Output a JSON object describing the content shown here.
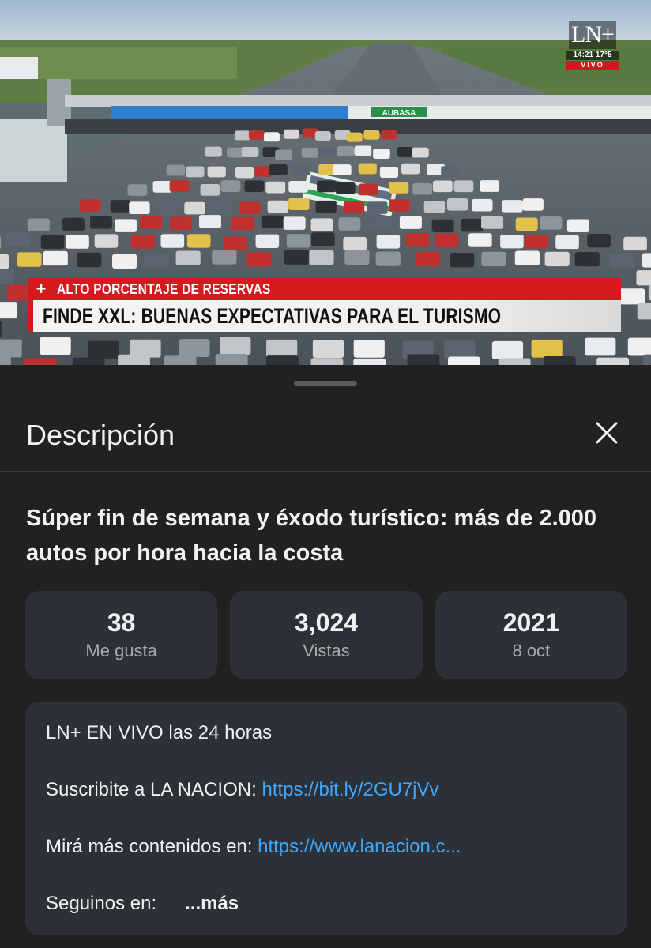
{
  "video": {
    "channel_logo": "LN+",
    "overlay_time": "14:21 17°5",
    "overlay_live": "VIVO",
    "toll_sign": "AUBASA",
    "lower_third": {
      "kicker": "ALTO PORCENTAJE DE RESERVAS",
      "headline": "FINDE XXL: BUENAS EXPECTATIVAS PARA EL TURISMO"
    }
  },
  "sheet": {
    "title": "Descripción",
    "close_icon": "close-icon",
    "video_title": "Súper fin de semana y éxodo turístico: más de 2.000 autos por hora hacia la costa",
    "stats": [
      {
        "value": "38",
        "label": "Me gusta"
      },
      {
        "value": "3,024",
        "label": "Vistas"
      },
      {
        "value": "2021",
        "label": "8 oct"
      }
    ],
    "description": {
      "line1": "LN+ EN VIVO las 24 horas",
      "line2_text": "Suscribite a LA NACION: ",
      "line2_link": "https://bit.ly/2GU7jVv",
      "line3_text": "Mirá más contenidos en: ",
      "line3_link": "https://www.lanacion.c...",
      "line4_text": "Seguinos en:",
      "more_label": "...más"
    }
  },
  "colors": {
    "background": "#0f0f0f",
    "sheet": "#212121",
    "card": "#2b3136",
    "link": "#3ea6ff",
    "news_red": "#d51a1f"
  }
}
